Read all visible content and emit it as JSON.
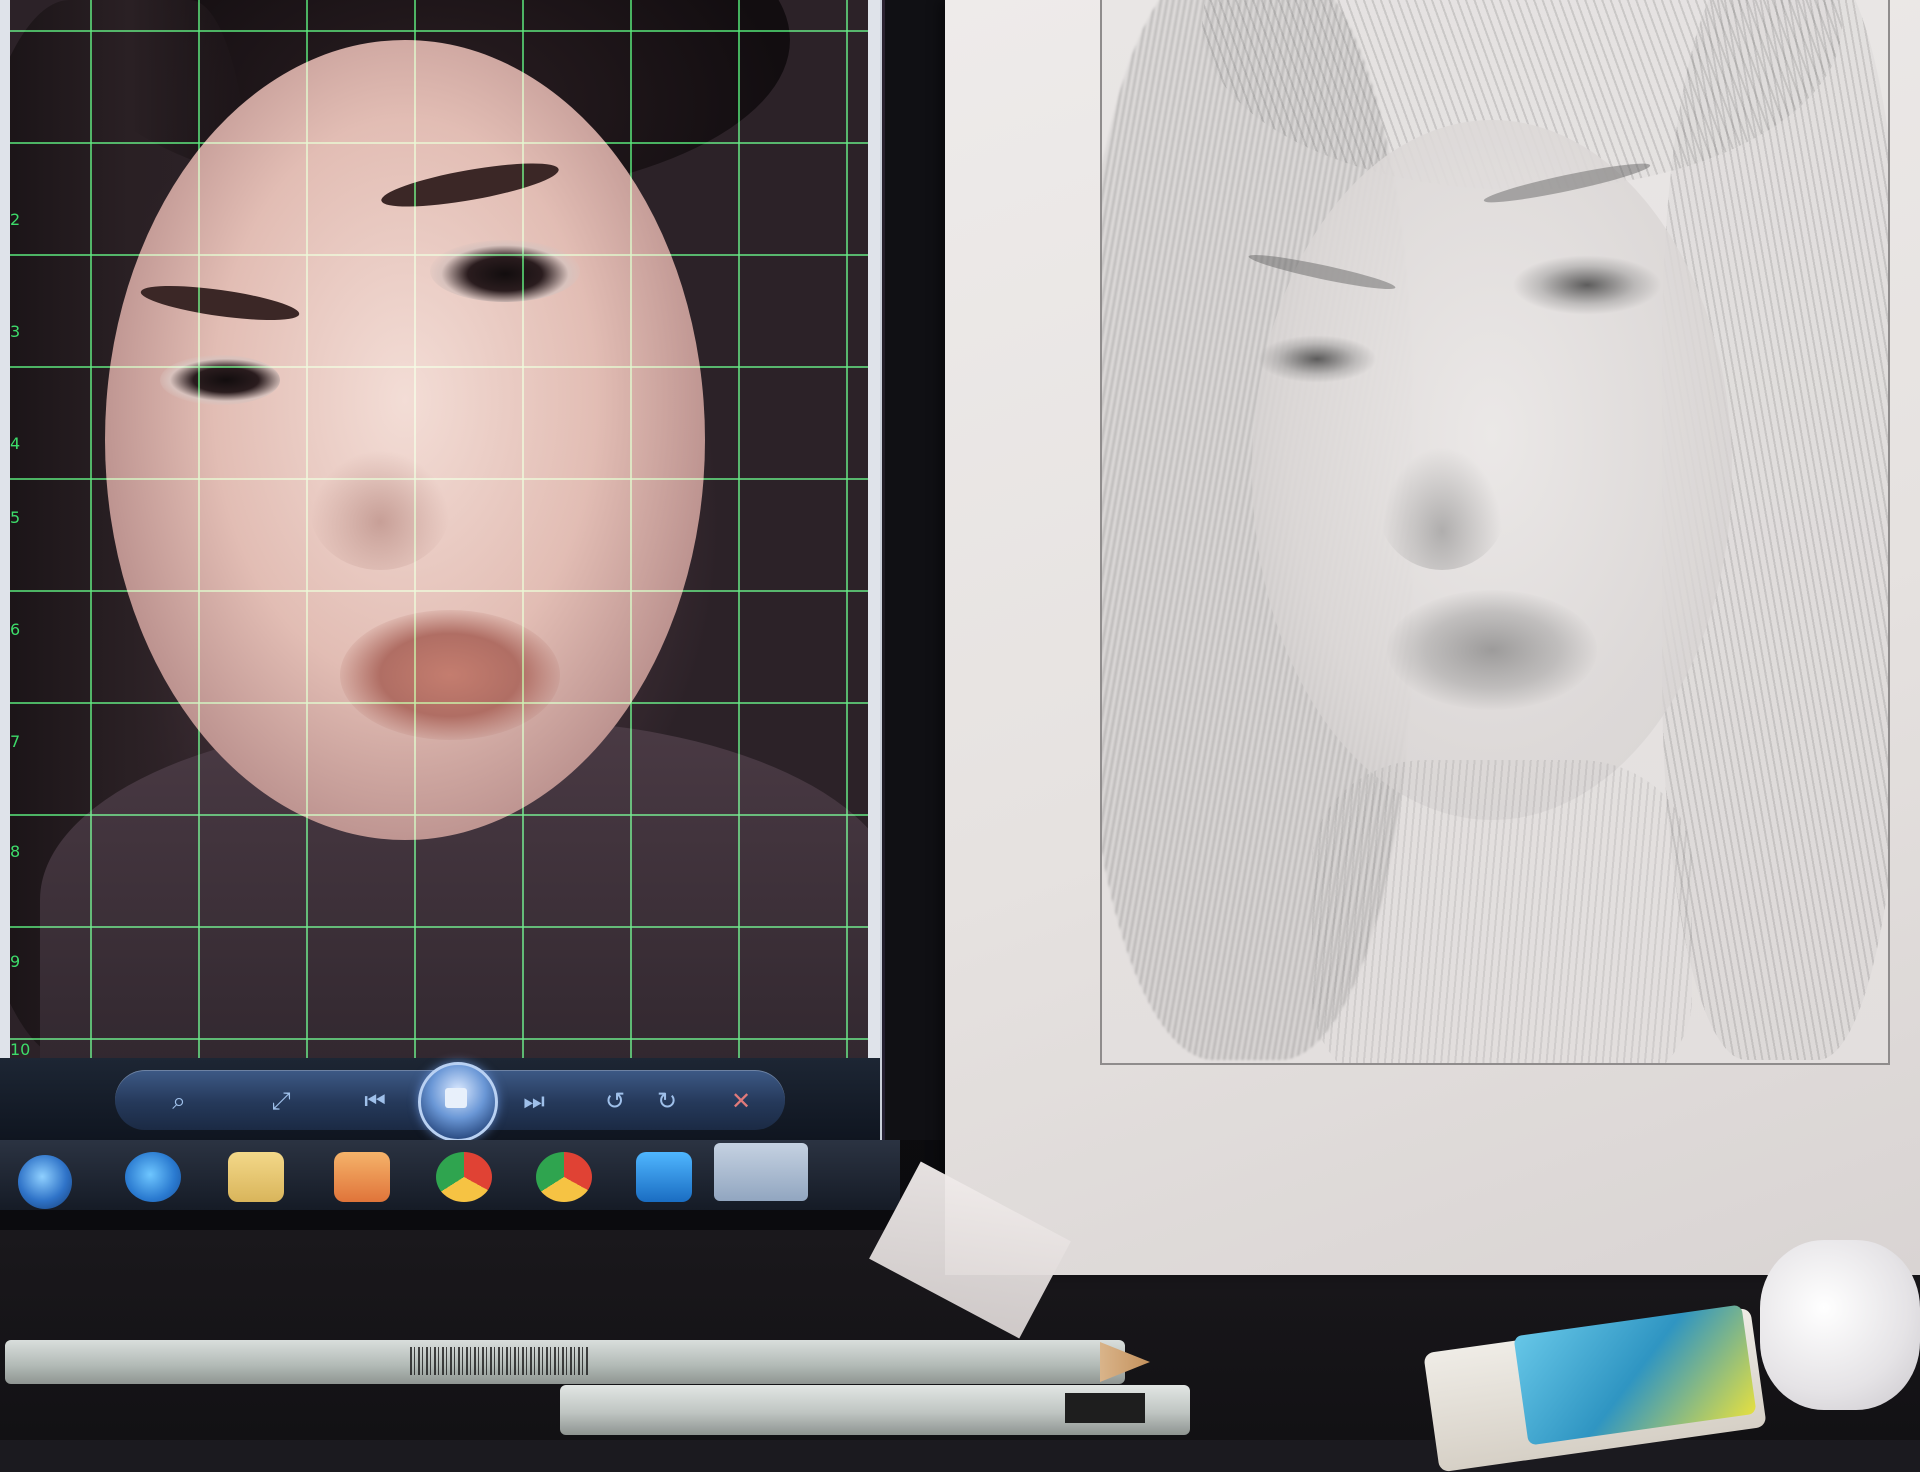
{
  "scene": {
    "photo_grid": {
      "row_numbers": [
        "2",
        "3",
        "4",
        "5",
        "6",
        "7",
        "8",
        "9",
        "10"
      ]
    },
    "viewer_toolbar": {
      "buttons": [
        {
          "icon": "zoom-icon",
          "glyph": "⌕"
        },
        {
          "icon": "fit-window-icon",
          "glyph": "⤢"
        },
        {
          "icon": "previous-icon",
          "glyph": "⏮"
        },
        {
          "icon": "slideshow-icon",
          "glyph": ""
        },
        {
          "icon": "next-icon",
          "glyph": "⏭"
        },
        {
          "icon": "rotate-left-icon",
          "glyph": "↺"
        },
        {
          "icon": "rotate-right-icon",
          "glyph": "↻"
        },
        {
          "icon": "delete-icon",
          "glyph": "✕"
        }
      ]
    },
    "taskbar": {
      "items": [
        "start-orb",
        "internet-explorer-icon",
        "folder-icon",
        "media-player-icon",
        "chrome-icon",
        "chrome-canary-icon",
        "photo-gallery-icon",
        "photo-viewer-task"
      ]
    },
    "colors": {
      "grid_line": "#46e66e",
      "toolbar": "#25395a",
      "paper": "#e8e4e3"
    }
  }
}
